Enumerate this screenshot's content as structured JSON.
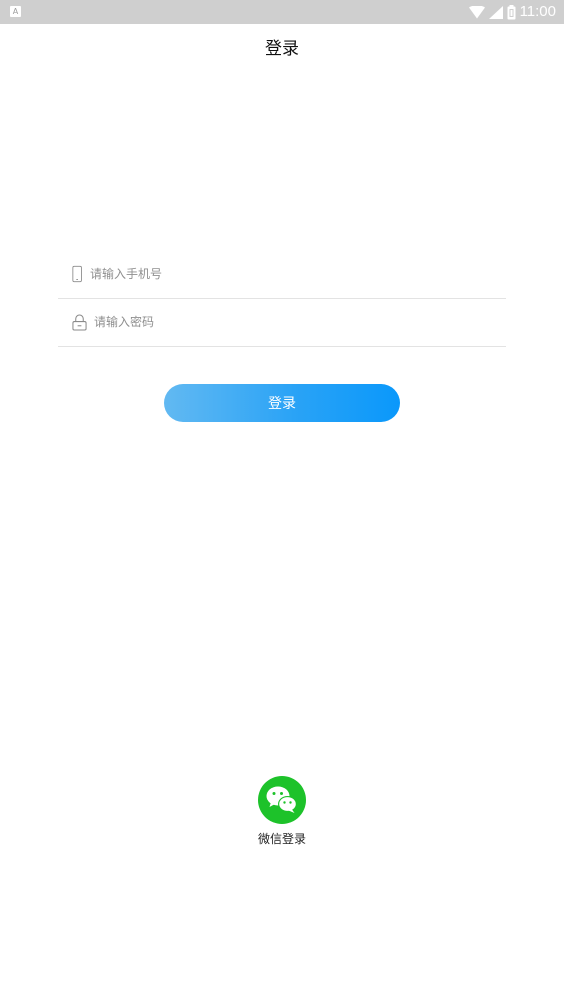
{
  "status_bar": {
    "left_icon_text": "A",
    "time": "11:00",
    "icons": [
      "wifi-icon",
      "signal-icon",
      "battery-icon"
    ]
  },
  "header": {
    "title": "登录"
  },
  "form": {
    "phone": {
      "placeholder": "请输入手机号",
      "value": "",
      "icon": "phone-icon"
    },
    "password": {
      "placeholder": "请输入密码",
      "value": "",
      "icon": "lock-icon"
    },
    "login_label": "登录"
  },
  "wechat": {
    "label": "微信登录",
    "icon": "wechat-icon"
  },
  "colors": {
    "status_bar": "#cfcfcf",
    "button_gradient_start": "#62b9f2",
    "button_gradient_end": "#0a98fb",
    "wechat_green": "#1dc22a",
    "divider": "#e3e3e3"
  }
}
